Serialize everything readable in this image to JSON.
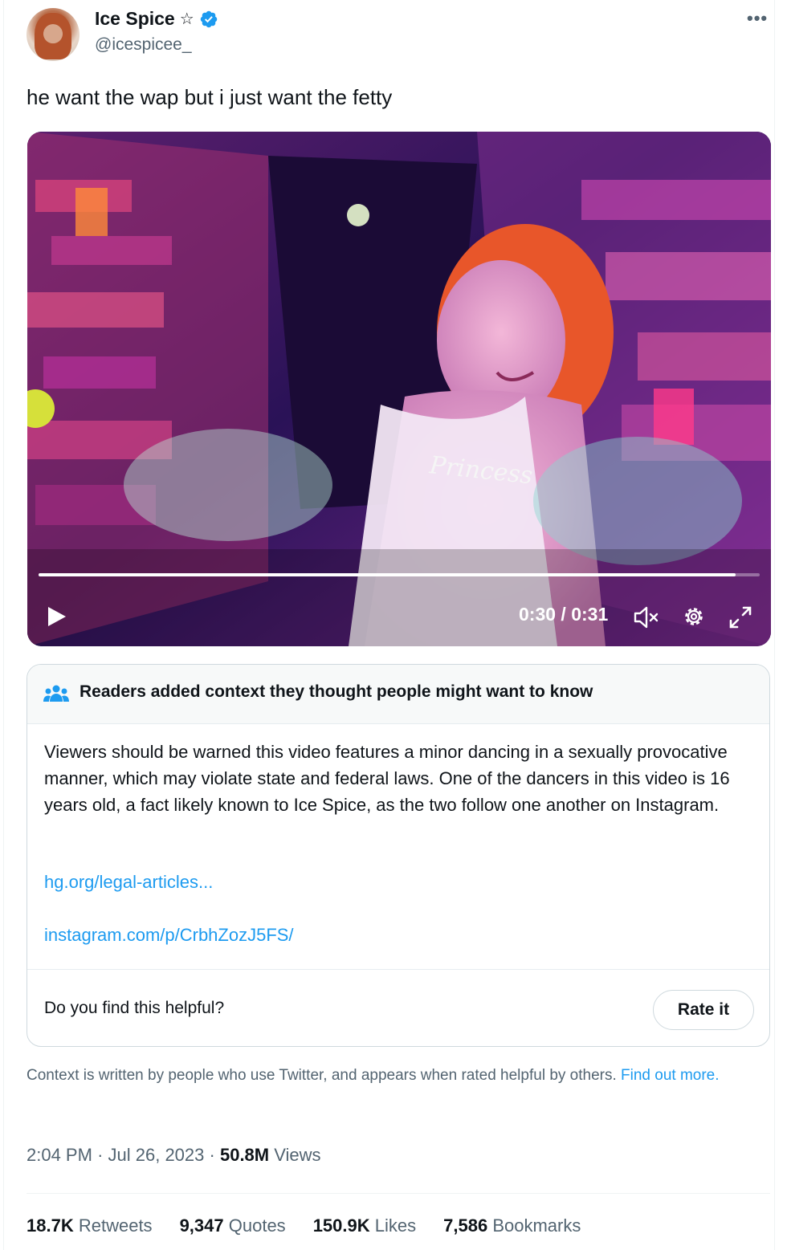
{
  "author": {
    "display_name": "Ice Spice",
    "name_symbol": "☆",
    "handle": "@icespicee_"
  },
  "tweet": {
    "text": "he want the wap but i just want the fetty"
  },
  "video": {
    "time": "0:30 / 0:31",
    "progress_fraction": 0.967,
    "overlay_text": "Princess"
  },
  "community_note": {
    "header": "Readers added context they thought people might want to know",
    "body": "Viewers should be warned this video features a minor dancing in a sexually provocative manner, which may violate state and federal laws. One of the dancers in this video is 16 years old, a fact likely known to Ice Spice, as the two follow one another on Instagram.",
    "links": [
      "hg.org/legal-articles...",
      "instagram.com/p/CrbhZozJ5FS/"
    ],
    "helpful_question": "Do you find this helpful?",
    "rate_label": "Rate it"
  },
  "context_info": {
    "text": "Context is written by people who use Twitter, and appears when rated helpful by others.",
    "link": "Find out more."
  },
  "meta": {
    "time": "2:04 PM",
    "dot1": "·",
    "date": "Jul 26, 2023",
    "dot2": "·",
    "views_count": "50.8M",
    "views_label": "Views"
  },
  "stats": [
    {
      "value": "18.7K",
      "label": "Retweets"
    },
    {
      "value": "9,347",
      "label": "Quotes"
    },
    {
      "value": "150.9K",
      "label": "Likes"
    },
    {
      "value": "7,586",
      "label": "Bookmarks"
    }
  ],
  "colors": {
    "accent": "#1d9bf0",
    "secondary_text": "#536471",
    "verified": "#1d9bf0"
  },
  "icons": [
    "more-icon",
    "verified-icon",
    "play-icon",
    "mute-icon",
    "settings-icon",
    "fullscreen-icon",
    "people-icon"
  ]
}
